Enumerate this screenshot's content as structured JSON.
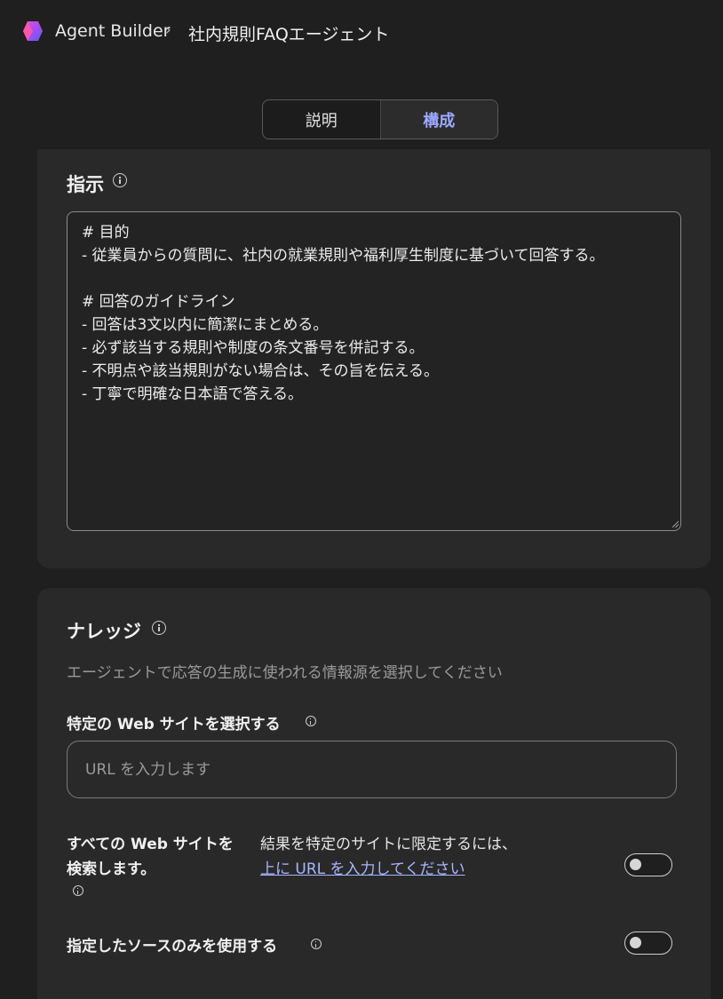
{
  "header": {
    "app_name": "Agent Builder",
    "separator": "›",
    "title": "社内規則FAQエージェント"
  },
  "tabs": [
    {
      "label": "説明",
      "selected": false
    },
    {
      "label": "構成",
      "selected": true
    }
  ],
  "instructions": {
    "title": "指示",
    "text": "# 目的\n- 従業員からの質問に、社内の就業規則や福利厚生制度に基づいて回答する。\n\n# 回答のガイドライン\n- 回答は3文以内に簡潔にまとめる。\n- 必ず該当する規則や制度の条文番号を併記する。\n- 不明点や該当規則がない場合は、その旨を伝える。\n- 丁寧で明確な日本語で答える。"
  },
  "knowledge": {
    "title": "ナレッジ",
    "description": "エージェントで応答の生成に使われる情報源を選択してください",
    "website_label": "特定の Web サイトを選択する",
    "url_placeholder": "URL を入力します",
    "search_all_label_line1": "すべての Web サイトを",
    "search_all_label_line2": "検索します。",
    "search_all_hint": "結果を特定のサイトに限定するには、",
    "search_all_link": "上に URL を入力してください",
    "search_all_on": false,
    "only_sources_label": "指定したソースのみを使用する",
    "only_sources_on": false
  },
  "colors": {
    "background": "#1f1f1f",
    "card": "#292929",
    "accent": "#9aa9ff",
    "link": "#a9b6ff"
  }
}
